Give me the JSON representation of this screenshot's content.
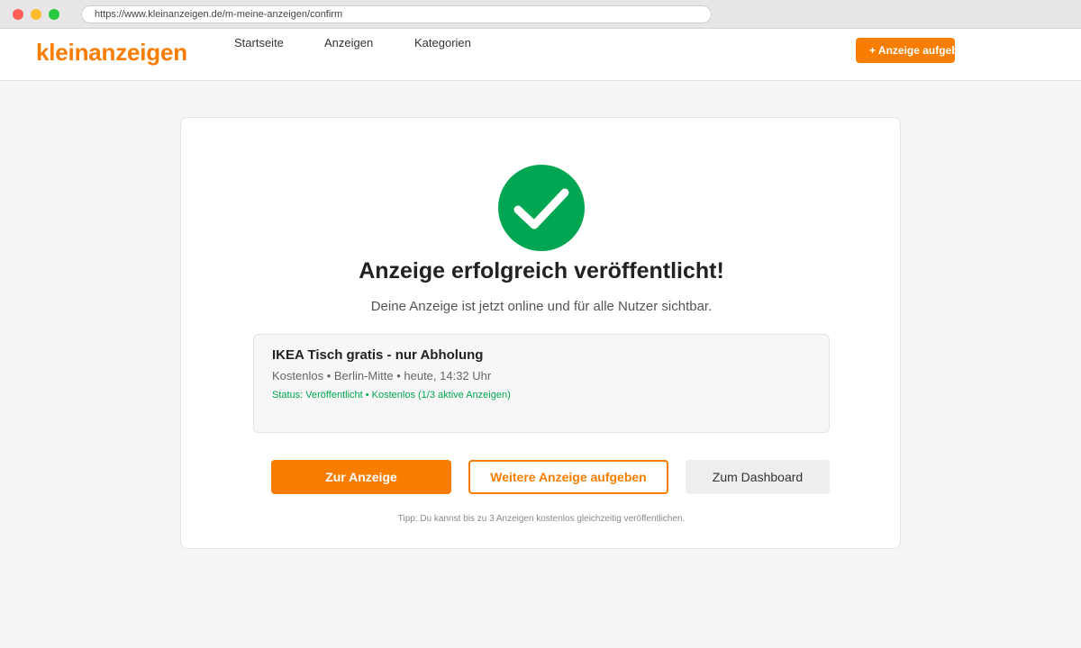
{
  "browser": {
    "url": "https://www.kleinanzeigen.de/m-meine-anzeigen/confirm"
  },
  "header": {
    "logo": "kleinanzeigen",
    "nav": [
      {
        "label": "Startseite"
      },
      {
        "label": "Anzeigen"
      },
      {
        "label": "Kategorien"
      }
    ],
    "post_button": "+ Anzeige aufgeben"
  },
  "confirmation": {
    "title": "Anzeige erfolgreich veröffentlicht!",
    "subtitle": "Deine Anzeige ist jetzt online und für alle Nutzer sichtbar.",
    "ad": {
      "title": "IKEA Tisch gratis - nur Abholung",
      "meta": "Kostenlos • Berlin-Mitte • heute, 14:32 Uhr",
      "status": "Status: Veröffentlicht • Kostenlos (1/3 aktive Anzeigen)"
    },
    "buttons": {
      "view_ad": "Zur Anzeige",
      "post_another": "Weitere Anzeige aufgeben",
      "dashboard": "Zum Dashboard"
    },
    "tip": "Tipp: Du kannst bis zu 3 Anzeigen kostenlos gleichzeitig veröffentlichen."
  },
  "colors": {
    "brand": "#f87d00",
    "success": "#00a651"
  },
  "icons": {
    "success": "checkmark-circle-icon"
  }
}
